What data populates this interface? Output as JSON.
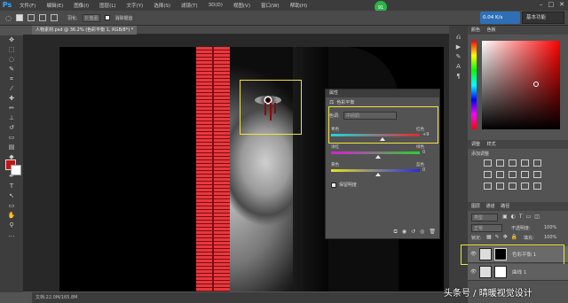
{
  "app": {
    "logo": "Ps"
  },
  "menu": [
    "文件(F)",
    "编辑(E)",
    "图像(I)",
    "图层(L)",
    "文字(Y)",
    "选择(S)",
    "滤镜(T)",
    "3D(D)",
    "视图(V)",
    "窗口(W)",
    "帮助(H)"
  ],
  "options": {
    "feather_label": "羽化:",
    "feather_value": "0 像素",
    "antialias_label": "消除锯齿"
  },
  "badge": {
    "number": "91"
  },
  "network": {
    "label": "0.04 K/s"
  },
  "workspace": {
    "label": "基本功能"
  },
  "document": {
    "tab_label": "人物素材.psd @ 36.2% (色彩平衡 1, RGB/8*) *",
    "status": "文档:22.0M/165.8M"
  },
  "properties": {
    "header": "属性",
    "title": "色彩平衡",
    "tone_label": "色调:",
    "tone_value": "中间调",
    "sliders": [
      {
        "left": "青色",
        "right": "红色",
        "value": "+9",
        "position": 0.55
      },
      {
        "left": "洋红",
        "right": "绿色",
        "value": "0",
        "position": 0.5
      },
      {
        "left": "黄色",
        "right": "蓝色",
        "value": "0",
        "position": 0.5
      }
    ],
    "preserve_label": "保留明度"
  },
  "right_panel": {
    "color_tabs": [
      "颜色",
      "色板"
    ],
    "adjust_tabs": [
      "调整",
      "样式"
    ],
    "adjust_title": "添加调整",
    "layer_tabs": [
      "图层",
      "通道",
      "路径"
    ],
    "filter_label": "类型",
    "blend_mode": "正常",
    "opacity_label": "不透明度:",
    "opacity_value": "100%",
    "lock_label": "锁定:",
    "fill_label": "填充:",
    "fill_value": "100%",
    "layers": [
      "色彩平衡 1",
      "曲线 1"
    ]
  },
  "watermark": {
    "text": "头条号 / 晴暖视觉设计"
  },
  "colors": {
    "foreground": "#c0171b",
    "background": "#ffffff",
    "highlight": "#f0e53a"
  }
}
